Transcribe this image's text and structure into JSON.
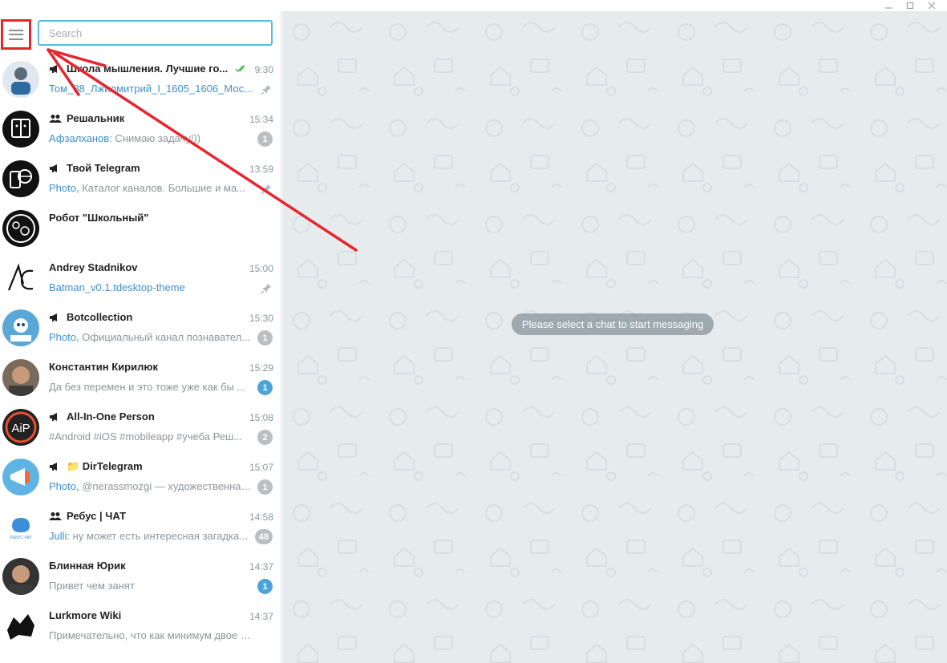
{
  "window": {
    "controls": [
      "minimize-icon",
      "maximize-icon",
      "close-icon"
    ]
  },
  "sidebar": {
    "menu_icon": "hamburger-menu-icon",
    "search": {
      "placeholder": "Search",
      "value": ""
    }
  },
  "chats": [
    {
      "name": "Школа мышления. Лучшие го...",
      "type": "channel",
      "time": "9:30",
      "sender": "Том_88_Лжилмитрий_I_1605_1606_Мос...",
      "text": "",
      "pinned": true,
      "read": true
    },
    {
      "name": "Решальник",
      "type": "group",
      "time": "15:34",
      "sender": "Афзалханов:",
      "text": " Снимаю задачу!))",
      "badge": "1",
      "badge_active": false
    },
    {
      "name": "Твой Telegram",
      "type": "channel",
      "time": "13:59",
      "sender": "Photo,",
      "text": " Каталог каналов. Большие и ма...",
      "pinned": true
    },
    {
      "name": "Робот \"Школьный\"",
      "type": "user",
      "time": "",
      "sender": "",
      "text": ""
    },
    {
      "name": "Andrey Stadnikov",
      "type": "user",
      "time": "15:00",
      "sender": "Batman_v0.1.tdesktop-theme",
      "text": "",
      "pinned": true
    },
    {
      "name": "Botcollection",
      "type": "channel",
      "time": "15:30",
      "sender": "Photo,",
      "text": " Официальный канал познавател...",
      "badge": "1",
      "badge_active": false
    },
    {
      "name": "Константин Кирилюк",
      "type": "user",
      "time": "15:29",
      "sender": "",
      "text": "Да без перемен и это тоже уже как бы ...",
      "badge": "1",
      "badge_active": true
    },
    {
      "name": "All-In-One Person",
      "type": "channel",
      "time": "15:08",
      "sender": "",
      "text": "#Android #iOS #mobileapp #учеба  Реш...",
      "badge": "2",
      "badge_active": false
    },
    {
      "name": "📁 DirTelegram",
      "type": "channel",
      "time": "15:07",
      "sender": "Photo,",
      "text": " @nerassmozgi — художественная #л...",
      "badge": "1",
      "badge_active": false
    },
    {
      "name": "Ребус | ЧАТ",
      "type": "group",
      "time": "14:58",
      "sender": "Julli:",
      "text": " ну может есть интересная загадка...",
      "badge": "48",
      "badge_active": false
    },
    {
      "name": "Блинная Юрик",
      "type": "user",
      "time": "14:37",
      "sender": "",
      "text": "Привет чем занят",
      "badge": "1",
      "badge_active": true
    },
    {
      "name": "Lurkmore Wiki",
      "type": "user",
      "time": "14:37",
      "sender": "",
      "text": "Примечательно, что как минимум двое бу..."
    }
  ],
  "main": {
    "empty_state": "Please select a chat to start messaging"
  },
  "colors": {
    "accent": "#5eb8e6",
    "annotation": "#e5262d",
    "chat_bg": "#e6ebee",
    "link": "#3d8fc9"
  }
}
